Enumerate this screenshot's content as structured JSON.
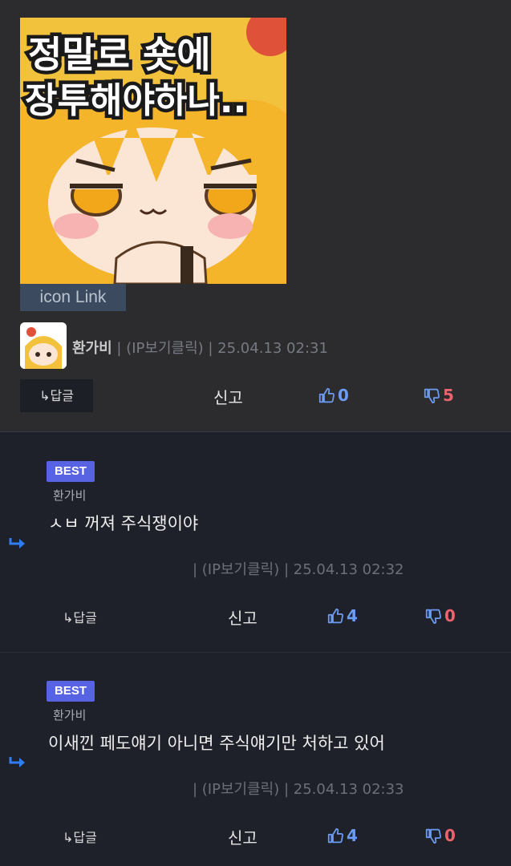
{
  "post": {
    "sticker_text_line1": "정말로 숏에",
    "sticker_text_line2": "장투해야하나..",
    "icon_link_label": "icon Link",
    "author": "환가비",
    "meta": "| (IP보기클릭) | 25.04.13 02:31",
    "reply_label": "↳답글",
    "report_label": "신고",
    "likes": "0",
    "dislikes": "5"
  },
  "comments": [
    {
      "badge": "BEST",
      "author": "환가비",
      "text": "ㅅㅂ 꺼져 주식쟁이야",
      "meta": "| (IP보기클릭) | 25.04.13 02:32",
      "reply_label": "↳답글",
      "report_label": "신고",
      "likes": "4",
      "dislikes": "0"
    },
    {
      "badge": "BEST",
      "author": "환가비",
      "text": "이새낀 페도얘기 아니면 주식얘기만 처하고 있어",
      "meta": "| (IP보기클릭) | 25.04.13 02:33",
      "reply_label": "↳답글",
      "report_label": "신고",
      "likes": "4",
      "dislikes": "0"
    }
  ],
  "colors": {
    "like": "#6b9bf2",
    "dislike": "#e9646c",
    "best_badge": "#5863e3",
    "post_bg": "#2c2c2e",
    "comment_bg": "#1e2129"
  },
  "icons": [
    "thumbs-up-icon",
    "thumbs-down-icon",
    "reply-arrow-icon"
  ]
}
